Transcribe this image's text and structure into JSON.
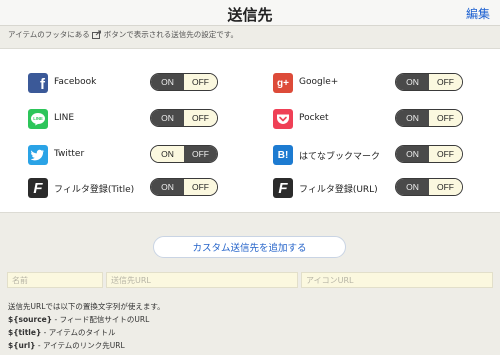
{
  "header": {
    "title": "送信先",
    "edit_label": "編集"
  },
  "description": {
    "before": "アイテムのフッタにある",
    "after": "ボタンで表示される送信先の設定です。"
  },
  "toggle": {
    "on_label": "ON",
    "off_label": "OFF"
  },
  "services": [
    {
      "label": "Facebook",
      "icon": "facebook-icon",
      "glyph": "f",
      "color": "#3b5998",
      "state": "off"
    },
    {
      "label": "Google+",
      "icon": "googleplus-icon",
      "glyph": "g+",
      "color": "#dd4b39",
      "state": "off"
    },
    {
      "label": "LINE",
      "icon": "line-icon",
      "glyph": "LINE",
      "color": "#2dc55a",
      "state": "off"
    },
    {
      "label": "Pocket",
      "icon": "pocket-icon",
      "glyph": "❯",
      "color": "#ef4056",
      "state": "off"
    },
    {
      "label": "Twitter",
      "icon": "twitter-icon",
      "glyph": "🐦",
      "color": "#2aa3e6",
      "state": "on"
    },
    {
      "label": "はてなブックマーク",
      "icon": "hatena-bookmark-icon",
      "glyph": "B!",
      "color": "#1d7bd1",
      "state": "off"
    },
    {
      "label": "フィルタ登録(Title)",
      "icon": "filter-title-icon",
      "glyph": "F",
      "color": "#2b2b2b",
      "state": "off"
    },
    {
      "label": "フィルタ登録(URL)",
      "icon": "filter-url-icon",
      "glyph": "F",
      "color": "#2b2b2b",
      "state": "off"
    }
  ],
  "add_button_label": "カスタム送信先を追加する",
  "form": {
    "name_placeholder": "名前",
    "url_placeholder": "送信先URL",
    "icon_placeholder": "アイコンURL"
  },
  "help": {
    "intro": "送信先URLでは以下の置換文字列が使えます。",
    "lines": [
      {
        "key": "${source}",
        "text": " - フィード配信サイトのURL"
      },
      {
        "key": "${title}",
        "text": " - アイテムのタイトル"
      },
      {
        "key": "${url}",
        "text": " - アイテムのリンク先URL"
      }
    ]
  },
  "colors": {
    "accent": "#1a5fd1",
    "toggle_dark": "#4a4a4a",
    "toggle_light": "#fbf8df"
  }
}
